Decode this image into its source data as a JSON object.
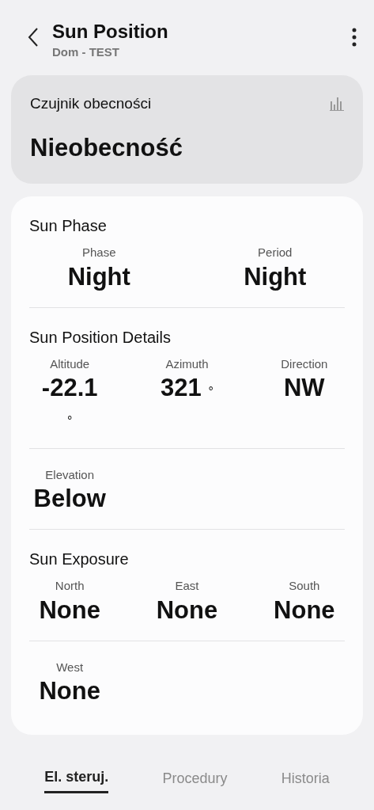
{
  "header": {
    "title": "Sun Position",
    "subtitle": "Dom - TEST"
  },
  "presence": {
    "label": "Czujnik obecności",
    "value": "Nieobecność"
  },
  "groups": [
    {
      "title": "Sun Phase",
      "items": [
        {
          "label": "Phase",
          "value": "Night"
        },
        {
          "label": "Period",
          "value": "Night"
        }
      ]
    },
    {
      "title": "Sun Position Details",
      "items": [
        {
          "label": "Altitude",
          "value": "-22.1",
          "unit": "°",
          "unit_on_new_line": true
        },
        {
          "label": "Azimuth",
          "value": "321",
          "unit": "°",
          "unit_on_new_line": false
        },
        {
          "label": "Direction",
          "value": "NW"
        }
      ]
    },
    {
      "items": [
        {
          "label": "Elevation",
          "value": "Below"
        }
      ]
    },
    {
      "title": "Sun Exposure",
      "items": [
        {
          "label": "North",
          "value": "None"
        },
        {
          "label": "East",
          "value": "None"
        },
        {
          "label": "South",
          "value": "None"
        }
      ]
    },
    {
      "items": [
        {
          "label": "West",
          "value": "None"
        }
      ]
    }
  ],
  "tabs": [
    {
      "label": "El. steruj.",
      "selected": true
    },
    {
      "label": "Procedury",
      "selected": false
    },
    {
      "label": "Historia",
      "selected": false
    }
  ]
}
